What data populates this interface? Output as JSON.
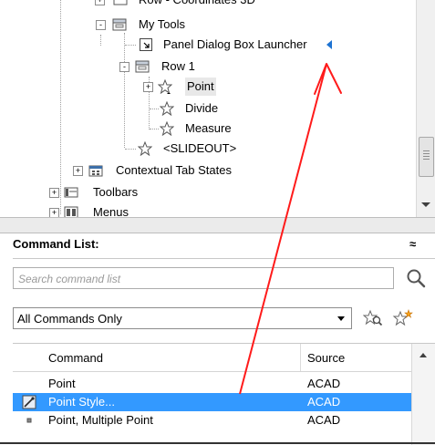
{
  "tree": {
    "items": [
      {
        "label": "Row - Coordinates 3D",
        "icon": "row-icon"
      },
      {
        "label": "My Tools",
        "icon": "panel-icon"
      },
      {
        "label": "Panel Dialog Box Launcher",
        "icon": "dialog-launcher-icon"
      },
      {
        "label": "Row 1",
        "icon": "row-icon"
      },
      {
        "label": "Point",
        "icon": "star-icon"
      },
      {
        "label": "Divide",
        "icon": "star-icon"
      },
      {
        "label": "Measure",
        "icon": "star-icon"
      },
      {
        "label": "<SLIDEOUT>",
        "icon": "star-icon"
      },
      {
        "label": "Contextual Tab States",
        "icon": "contextual-tab-icon"
      },
      {
        "label": "Toolbars",
        "icon": "toolbar-icon"
      },
      {
        "label": "Menus",
        "icon": "menu-icon"
      }
    ],
    "expanders": {
      "collapsed": "+",
      "expanded": "-"
    }
  },
  "command_list": {
    "title": "Command List:",
    "collapse_glyph": "≈",
    "search": {
      "placeholder": "Search command list",
      "value": ""
    },
    "filter": {
      "selected": "All Commands Only"
    },
    "table": {
      "columns": [
        "Command",
        "Source"
      ],
      "rows": [
        {
          "command": "Point",
          "source": "ACAD",
          "icon": "none",
          "selected": false
        },
        {
          "command": "Point Style...",
          "source": "ACAD",
          "icon": "point-style-icon",
          "selected": true
        },
        {
          "command": "Point, Multiple Point",
          "source": "ACAD",
          "icon": "multiple-point-icon",
          "selected": false
        }
      ]
    }
  },
  "colors": {
    "selection": "#3399ff",
    "annotation_arrow": "#ff0000",
    "marker_triangle": "#1e73d2"
  }
}
